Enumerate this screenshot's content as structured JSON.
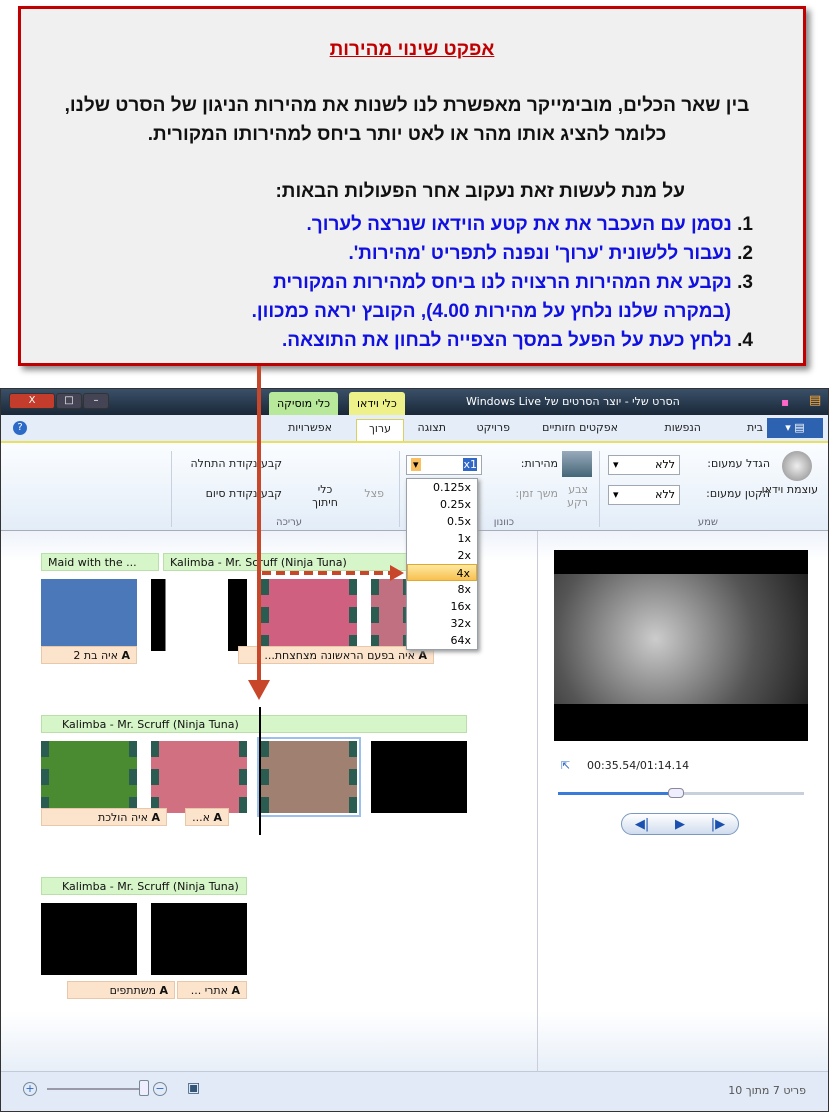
{
  "callout": {
    "title": "אפקט שינוי מהירות",
    "paragraph": "בין שאר הכלים, מובימייקר מאפשרת לנו לשנות את מהירות הניגון של הסרט שלנו, כלומר להציג אותו מהר או לאט יותר ביחס למהירותו המקורית.",
    "intro": "על מנת לעשות זאת נעקוב אחר הפעולות הבאות:",
    "steps": [
      {
        "n": "1.",
        "text": " נסמן עם העכבר את את קטע הוידאו שנרצה לערוך."
      },
      {
        "n": "2.",
        "text": " נעבור ללשונית 'ערוך' ונפנה לתפריט 'מהירות'."
      },
      {
        "n": "3.",
        "text": " נקבע את המהירות הרצויה לנו ביחס למהירות המקורית"
      },
      {
        "n": "",
        "text": "(במקרה שלנו נלחץ על מהירות 4.00), הקובץ יראה כמכוון."
      },
      {
        "n": "4.",
        "text": " נלחץ כעת על הפעל במסך הצפייה לבחון את התוצאה."
      }
    ],
    "accent": "#c00000",
    "step_color": "#1010e0"
  },
  "window": {
    "title": "הסרט שלי - יוצר הסרטים של Windows Live",
    "close": "X",
    "context_tabs": {
      "video": "כלי וידאו",
      "music": "כלי מוסיקה"
    }
  },
  "tabs": [
    "בית",
    "הנפשות",
    "אפקטים חזותיים",
    "פרויקט",
    "תצוגה",
    "ערוך",
    "אפשרויות"
  ],
  "ribbon": {
    "video_volume": "עוצמת וידאו",
    "fade_in_label": "הגדל עמעום:",
    "fade_in_value": "ללא",
    "fade_out_label": "הקטן עמעום:",
    "fade_out_value": "ללא",
    "audio_group": "שמע",
    "bg_color": "צבע רקע",
    "speed_label": "מהירות:",
    "speed_value": "x1",
    "duration_label": "משך זמן:",
    "adjust_group": "כוונון",
    "split": "פצל",
    "trim_tool": "כלי חיתוך",
    "set_start": "קבע נקודת התחלה",
    "set_end": "קבע נקודת סיום",
    "edit_group": "עריכה"
  },
  "speed_options": [
    "0.125x",
    "0.25x",
    "0.5x",
    "1x",
    "2x",
    "4x",
    "8x",
    "16x",
    "32x",
    "64x"
  ],
  "speed_selected": "4x",
  "storyboard": {
    "row1_music": [
      "Maid with the ...",
      "Kalimba - Mr. Scruff (Ninja Tuna)"
    ],
    "row1_captions": [
      "איה בת 2",
      "איה בפעם הראשונה מצחצחת..."
    ],
    "row2_music": "Kalimba - Mr. Scruff (Ninja Tuna)",
    "row2_captions": [
      "איה הולכת",
      "א..."
    ],
    "row3_music": "Kalimba - Mr. Scruff (Ninja Tuna)",
    "row3_captions": [
      "משתתפים",
      "אתרי ..."
    ],
    "caption_icon": "A"
  },
  "preview": {
    "time": "00:35.54/01:14.14",
    "progress": 0.48
  },
  "status": {
    "item_count": "פריט 7 מתוך 10"
  }
}
